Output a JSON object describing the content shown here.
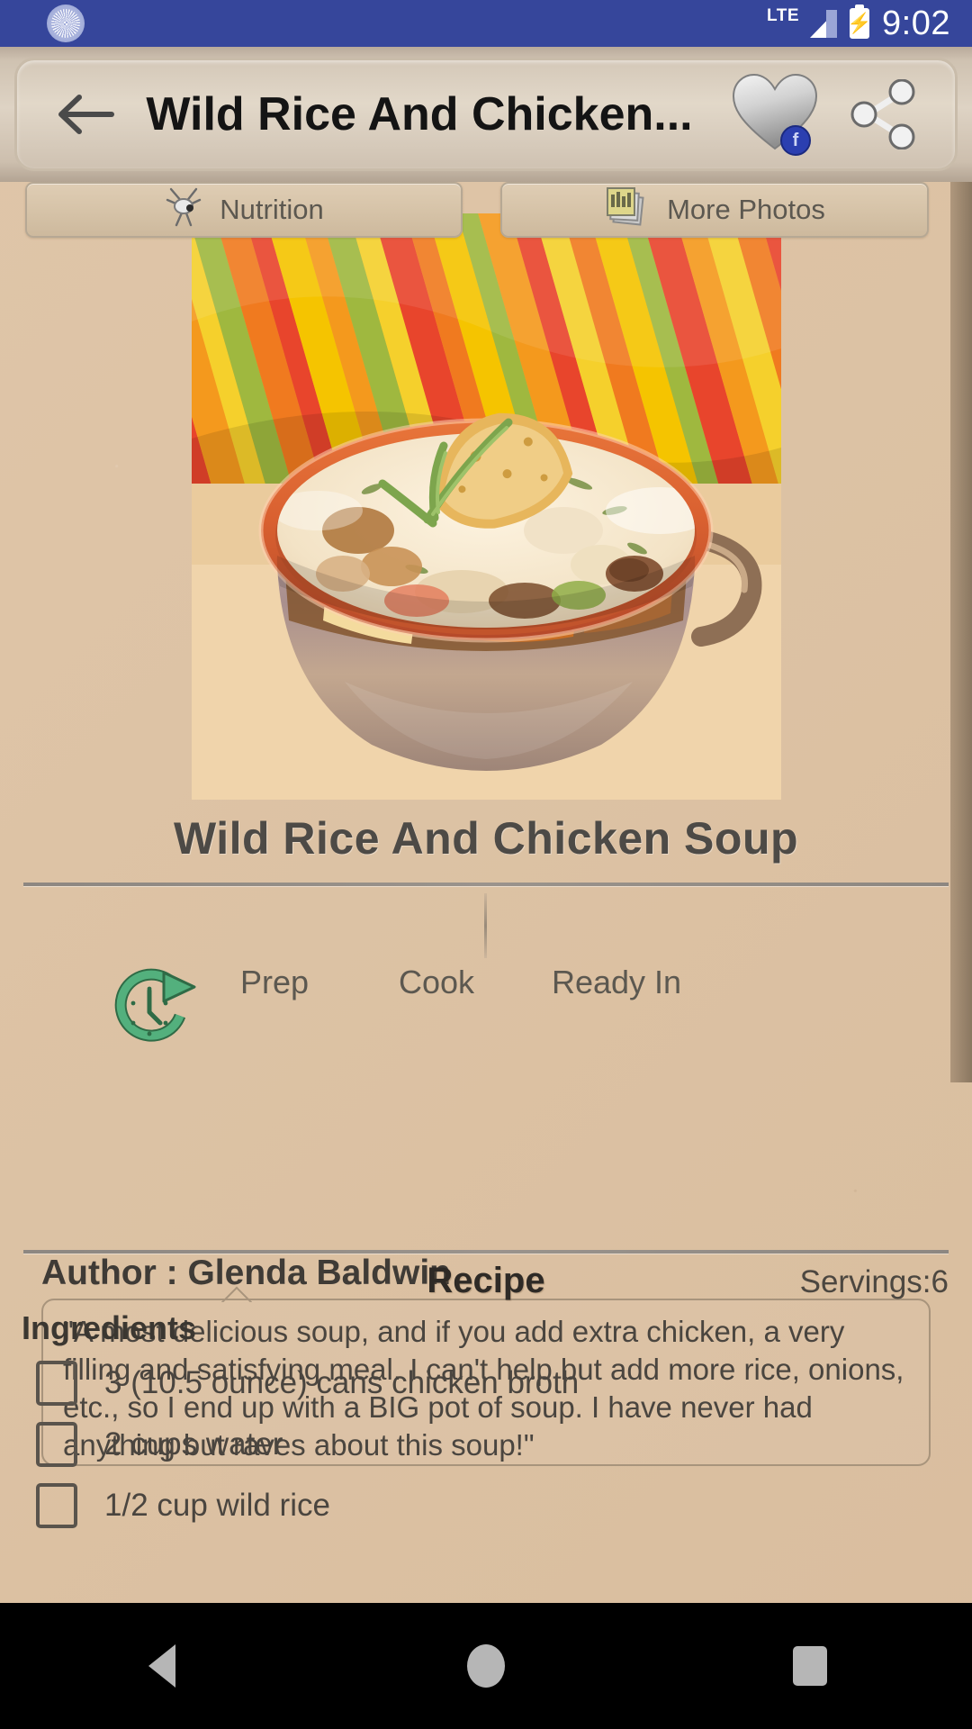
{
  "status_bar": {
    "app_icon": "app-badge-icon",
    "network": "LTE",
    "signal_icon": "signal-bars-icon",
    "battery_icon": "battery-charging-icon",
    "time": "9:02",
    "background_color": "#36469b"
  },
  "action_bar": {
    "back_icon": "back-arrow-icon",
    "title": "Wild Rice And Chicken...",
    "favorite_icon": "heart-icon",
    "favorite_badge": "f",
    "share_icon": "share-icon"
  },
  "recipe": {
    "hero_image_alt": "wild-rice-and-chicken-soup-photo",
    "title": "Wild Rice And Chicken Soup",
    "buttons": [
      {
        "label": "Nutrition",
        "icon": "nutrition-icon"
      },
      {
        "label": "More Photos",
        "icon": "photo-stack-icon"
      }
    ],
    "times": {
      "clock_icon": "clock-icon",
      "prep_label": "Prep",
      "prep_value": "",
      "cook_label": "Cook",
      "cook_value": "",
      "ready_label": "Ready In",
      "ready_value": ""
    },
    "author_label": "Author : Glenda Baldwin",
    "description": "\"A most delicious soup, and if you add extra chicken, a very filling and satisfying meal.  I can't help but add more rice, onions, etc., so I end up with a BIG pot of soup.  I have never had anything but raves about this soup!\"",
    "recipe_heading": "Recipe",
    "servings": "Servings:6",
    "ingredients_heading": "Ingredients",
    "ingredients": [
      "3 (10.5 ounce) cans chicken broth",
      "2 cups water",
      "1/2 cup wild rice"
    ]
  },
  "nav_bar": {
    "back": "nav-back-icon",
    "home": "nav-home-icon",
    "recents": "nav-recents-icon"
  },
  "colors": {
    "status_bar": "#36469b",
    "page_background": "#ddc2a3",
    "action_bar": "#d4c8b8",
    "text_dark": "#3f3b36",
    "clock_green": "#49a87a"
  }
}
